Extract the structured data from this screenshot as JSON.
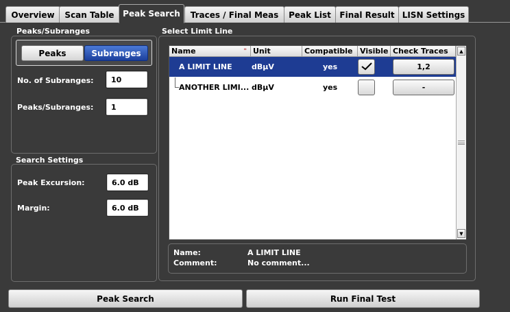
{
  "tabs": [
    {
      "label": "Overview",
      "active": false
    },
    {
      "label": "Scan Table",
      "active": false
    },
    {
      "label": "Peak Search",
      "active": true
    },
    {
      "label": "Traces / Final Meas",
      "active": false
    },
    {
      "label": "Peak List",
      "active": false
    },
    {
      "label": "Final Result",
      "active": false
    },
    {
      "label": "LISN Settings",
      "active": false
    }
  ],
  "peaks_subranges": {
    "title": "Peaks/Subranges",
    "toggle": {
      "peaks": "Peaks",
      "subranges": "Subranges",
      "selected": "Subranges"
    },
    "num_subranges_label": "No. of Subranges:",
    "num_subranges_value": "10",
    "peaks_per_subrange_label": "Peaks/Subranges:",
    "peaks_per_subrange_value": "1"
  },
  "search_settings": {
    "title": "Search Settings",
    "peak_excursion_label": "Peak Excursion:",
    "peak_excursion_value": "6.0 dB",
    "margin_label": "Margin:",
    "margin_value": "6.0 dB"
  },
  "limit_line": {
    "title": "Select Limit Line",
    "columns": [
      "Name",
      "Unit",
      "Compatible",
      "Visible",
      "Check Traces"
    ],
    "sort_marker": "\"",
    "rows": [
      {
        "name": "A LIMIT LINE",
        "unit": "dBµV",
        "compatible": "yes",
        "visible": true,
        "check_traces": "1,2",
        "selected": true
      },
      {
        "name": "ANOTHER LIMI...",
        "unit": "dBµV",
        "compatible": "yes",
        "visible": false,
        "check_traces": "-",
        "selected": false
      }
    ],
    "info": {
      "name_label": "Name:",
      "name_value": "A LIMIT LINE",
      "comment_label": "Comment:",
      "comment_value": "No comment..."
    }
  },
  "buttons": {
    "peak_search": "Peak Search",
    "run_final_test": "Run Final Test"
  },
  "colors": {
    "background": "#3a3a3a",
    "selection": "#1e3c93",
    "toggle_active": "#2a55b8"
  }
}
